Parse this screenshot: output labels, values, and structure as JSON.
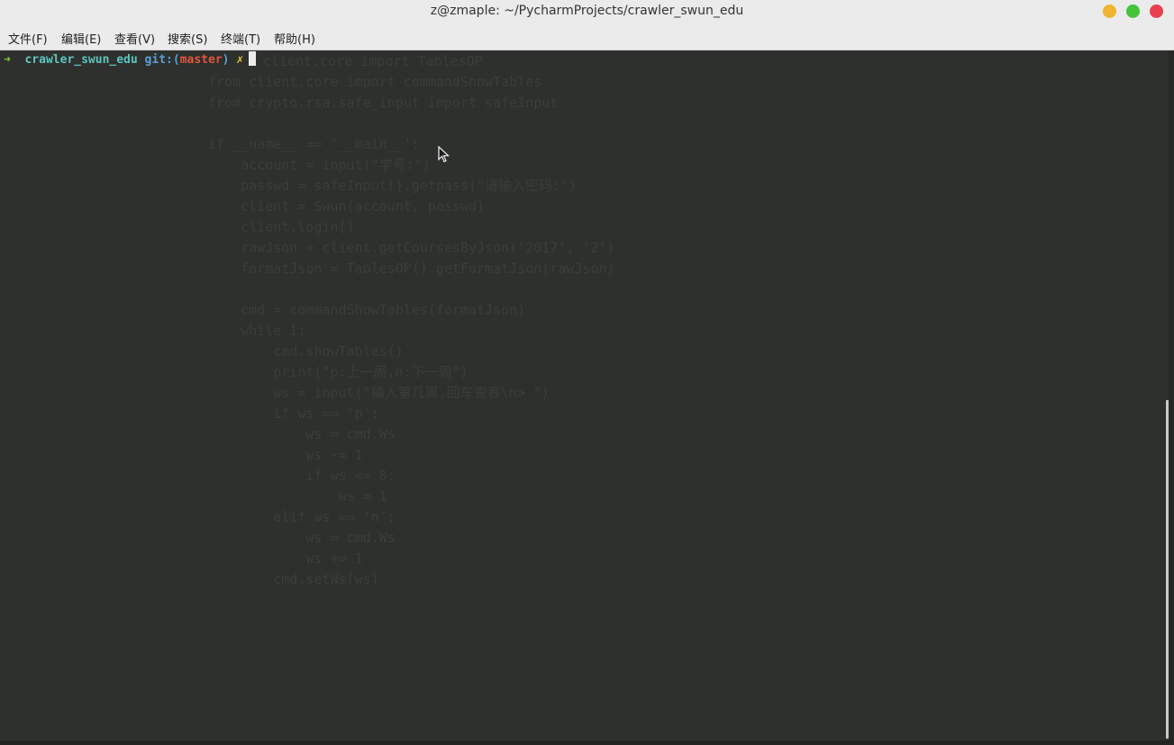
{
  "window": {
    "title": "z@zmaple: ~/PycharmProjects/crawler_swun_edu"
  },
  "menubar": {
    "items": [
      {
        "label": "文件(F)"
      },
      {
        "label": "编辑(E)"
      },
      {
        "label": "查看(V)"
      },
      {
        "label": "搜索(S)"
      },
      {
        "label": "终端(T)"
      },
      {
        "label": "帮助(H)"
      }
    ]
  },
  "terminal": {
    "prompt": {
      "arrow": "➜",
      "directory": "crawler_swun_edu",
      "git_prefix": "git:(",
      "branch": "master",
      "git_suffix": ")",
      "dirty_marker": "✗"
    }
  },
  "ghost_code": [
    "client.core import TablesOP",
    "from client.core import commandShowTables",
    "from crypto.rsa.safe_input import safeInput",
    "",
    "if __name__ == '__main__':",
    "    account = input(\"学号:\")",
    "    passwd = safeInput().getpass(\"请输入密码:\")",
    "    client = Swun(account, passwd)",
    "    client.login()",
    "    rawJson = client.getCoursesByJson('2017', '2')",
    "    formatJson = TablesOP().getFormatJson(rawJson)",
    "",
    "    cmd = commandShowTables(formatJson)",
    "    while 1:",
    "        cmd.showTables()",
    "        print(\"p:上一周,n:下一周\")",
    "        ws = input(\"输入第几周,回车查看\\n> \")",
    "        if ws == 'p':",
    "            ws = cmd.Ws",
    "            ws -= 1",
    "            if ws <= 0:",
    "                ws = 1",
    "        elif ws == 'n':",
    "            ws = cmd.Ws",
    "            ws += 1",
    "        cmd.setWs(ws)"
  ],
  "colors": {
    "terminal_bg": "#2e302d",
    "titlebar_bg": "#ebebeb",
    "prompt_arrow": "#7ec83e",
    "prompt_dir": "#5ec4c0",
    "prompt_git": "#5b9fd6",
    "prompt_branch": "#e0563e",
    "prompt_dirty": "#e8c842"
  }
}
